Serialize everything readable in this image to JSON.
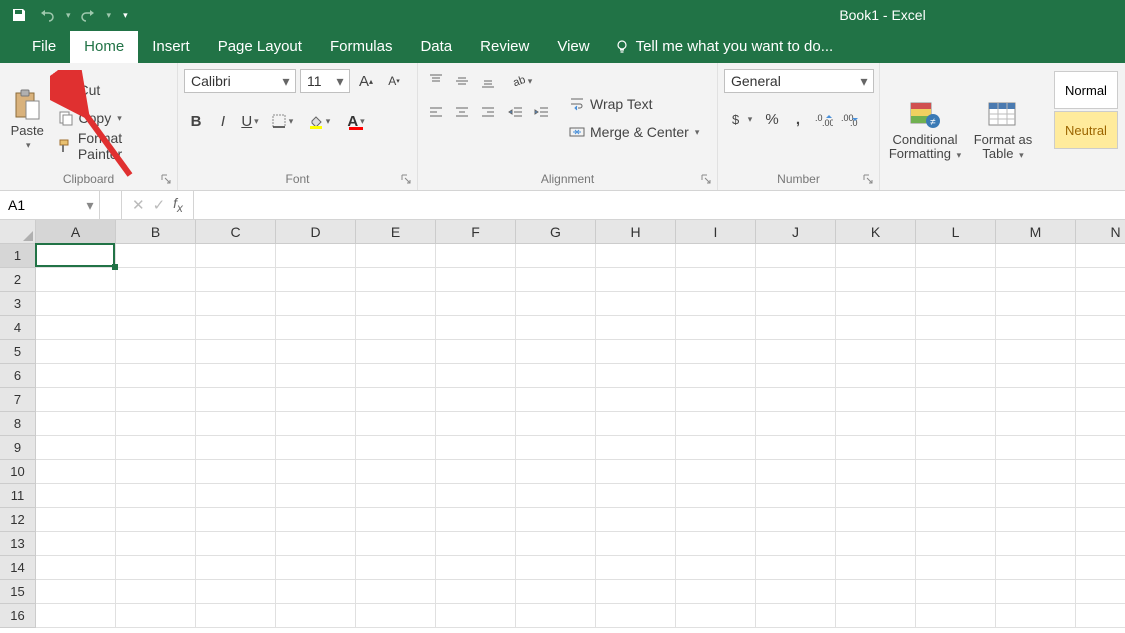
{
  "title": "Book1 - Excel",
  "tabs": [
    "File",
    "Home",
    "Insert",
    "Page Layout",
    "Formulas",
    "Data",
    "Review",
    "View"
  ],
  "active_tab": "Home",
  "tell_me": "Tell me what you want to do...",
  "clipboard": {
    "paste": "Paste",
    "cut": "Cut",
    "copy": "Copy",
    "format_painter": "Format Painter",
    "label": "Clipboard"
  },
  "font": {
    "name": "Calibri",
    "size": "11",
    "label": "Font"
  },
  "alignment": {
    "wrap": "Wrap Text",
    "merge": "Merge & Center",
    "label": "Alignment"
  },
  "number": {
    "format": "General",
    "label": "Number"
  },
  "styles": {
    "conditional": "Conditional Formatting",
    "format_as": "Format as Table",
    "normal": "Normal",
    "neutral": "Neutral"
  },
  "name_box": "A1",
  "columns": [
    "A",
    "B",
    "C",
    "D",
    "E",
    "F",
    "G",
    "H",
    "I",
    "J",
    "K",
    "L",
    "M",
    "N"
  ],
  "rows": [
    "1",
    "2",
    "3",
    "4",
    "5",
    "6",
    "7",
    "8",
    "9",
    "10",
    "11",
    "12",
    "13",
    "14",
    "15",
    "16"
  ],
  "selected": {
    "col": 0,
    "row": 0
  }
}
